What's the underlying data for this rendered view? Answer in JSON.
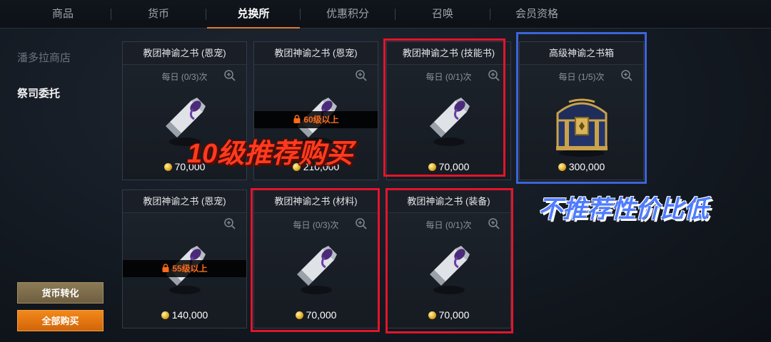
{
  "tabs": [
    {
      "label": "商品",
      "active": false
    },
    {
      "label": "货币",
      "active": false
    },
    {
      "label": "兑换所",
      "active": true
    },
    {
      "label": "优惠积分",
      "active": false
    },
    {
      "label": "召唤",
      "active": false
    },
    {
      "label": "会员资格",
      "active": false
    }
  ],
  "sidebar": {
    "items": [
      {
        "label": "潘多拉商店",
        "active": false
      },
      {
        "label": "祭司委托",
        "active": true
      }
    ],
    "convert_label": "货币转化",
    "buy_all_label": "全部购买"
  },
  "cards": [
    {
      "title": "教团神谕之书 (恩宠)",
      "daily": "每日 (0/3)次",
      "price": "70,000",
      "lock": null
    },
    {
      "title": "教团神谕之书 (恩宠)",
      "daily": "",
      "price": "210,000",
      "lock": "60级以上"
    },
    {
      "title": "教团神谕之书 (技能书)",
      "daily": "每日 (0/1)次",
      "price": "70,000",
      "lock": null
    },
    {
      "title": "高级神谕之书箱",
      "daily": "每日 (1/5)次",
      "price": "300,000",
      "lock": null
    },
    {
      "title": "教团神谕之书 (恩宠)",
      "daily": "",
      "price": "140,000",
      "lock": "55级以上"
    },
    {
      "title": "教团神谕之书 (材料)",
      "daily": "每日 (0/3)次",
      "price": "70,000",
      "lock": null
    },
    {
      "title": "教团神谕之书 (装备)",
      "daily": "每日 (0/1)次",
      "price": "70,000",
      "lock": null
    }
  ],
  "annotations": {
    "red_text": "10级推荐购买",
    "blue_text": "不推荐性价比低"
  },
  "colors": {
    "accent": "#e07a2a",
    "highlight_red": "#e3142b",
    "highlight_blue": "#3d64d8",
    "lock_text": "#ff6a1a"
  }
}
